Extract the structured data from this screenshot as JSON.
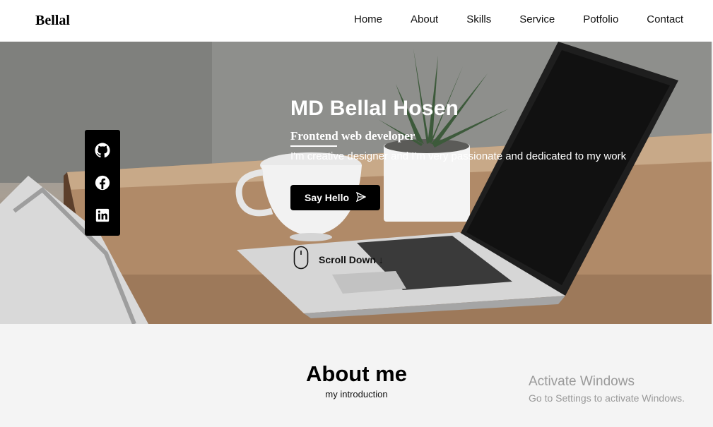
{
  "header": {
    "logo": "Bellal",
    "nav": [
      "Home",
      "About",
      "Skills",
      "Service",
      "Potfolio",
      "Contact"
    ]
  },
  "hero": {
    "name": "MD Bellal Hosen",
    "role": "Frontend web developer",
    "description": "I'm creative designer and I'm very passionate and dedicated to my work",
    "cta_label": "Say Hello",
    "scroll_label": "Scroll Down"
  },
  "social": {
    "icons": [
      "github-icon",
      "facebook-icon",
      "linkedin-icon"
    ]
  },
  "about": {
    "title": "About me",
    "subtitle": "my introduction"
  },
  "watermark": {
    "title": "Activate Windows",
    "subtitle": "Go to Settings to activate Windows."
  },
  "colors": {
    "header_bg": "#ffffff",
    "button_bg": "#000000",
    "page_bg": "#f4f4f4"
  }
}
